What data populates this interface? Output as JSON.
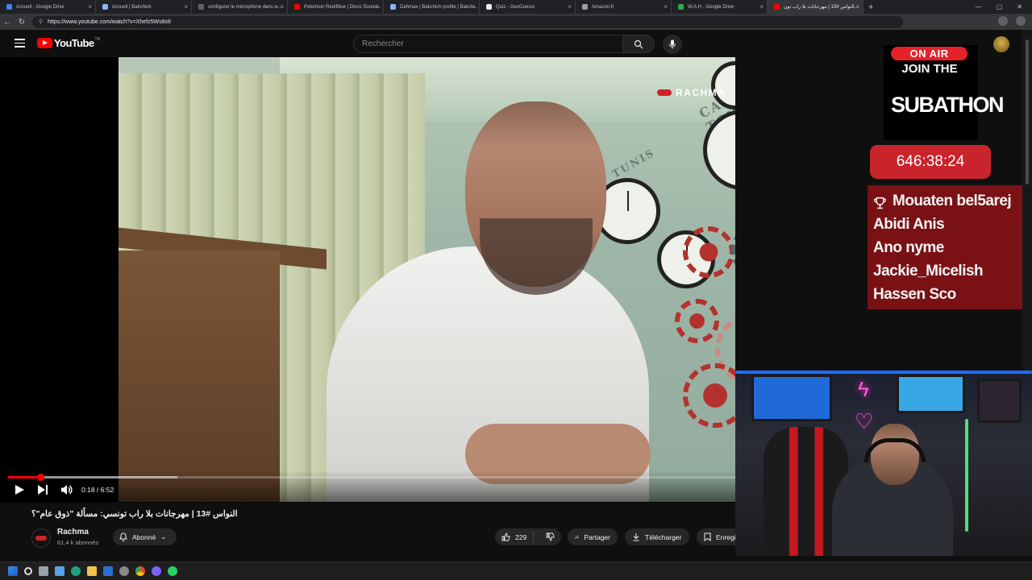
{
  "browser": {
    "tabs": [
      {
        "label": "Accueil - Google Drive",
        "color": "#4285f4"
      },
      {
        "label": "Accueil | Bakchich",
        "color": "#8ab4f8"
      },
      {
        "label": "configurer le microphone dans w...",
        "color": "#5f6368"
      },
      {
        "label": "Pokémon Red/Blue | Disco Sound...",
        "color": "#ff0000"
      },
      {
        "label": "Dahmax | Bakchich profile | Bakch...",
        "color": "#8ab4f8"
      },
      {
        "label": "Quiz - GeoGuessr",
        "color": "#e8eaed"
      },
      {
        "label": "Amazon.fr",
        "color": "#9aa0a6"
      },
      {
        "label": "W.A.H - Google Drive",
        "color": "#34a853"
      },
      {
        "label": "النواس #13 | مهرجانات بلا راب تون...",
        "color": "#ff0000",
        "active": true
      }
    ],
    "url": "https://www.youtube.com/watch?v=Xhefz5Ws8x8",
    "new_tab": "+"
  },
  "youtube": {
    "logo_word": "YouTube",
    "logo_country": "TN",
    "search_placeholder": "Rechercher"
  },
  "player": {
    "time_current": "0:18",
    "time_total": "6:52",
    "timecode": "0:18 / 6:52",
    "played_fraction": 0.044,
    "buffered_fraction": 0.233,
    "brand_overlay": "RACHMA",
    "wall_words": [
      "CAPE TOWN",
      "TUNIS"
    ]
  },
  "video": {
    "title": "النواس #13 | مهرجانات بلا راب تونسي: مسألة \"ذوق عام\"؟",
    "channel_name": "Rachma",
    "channel_subs": "61,4 k abonnés",
    "subscribe_label": "Abonné",
    "like_count": "229",
    "share_label": "Partager",
    "download_label": "Télécharger",
    "save_label": "Enregi"
  },
  "overlay": {
    "on_air": "ON AIR",
    "join_the": "JOIN THE",
    "subathon": "SUBATHON",
    "timer": "646:38:24",
    "donors": [
      "Mouaten bel5arej",
      "Abidi Anis",
      "Ano nyme",
      "Jackie_Micelish",
      "Hassen Sco"
    ],
    "colors": {
      "on_air_red": "#e5212a",
      "timer_red": "#c9242c",
      "donor_panel": "#8c1216"
    }
  }
}
